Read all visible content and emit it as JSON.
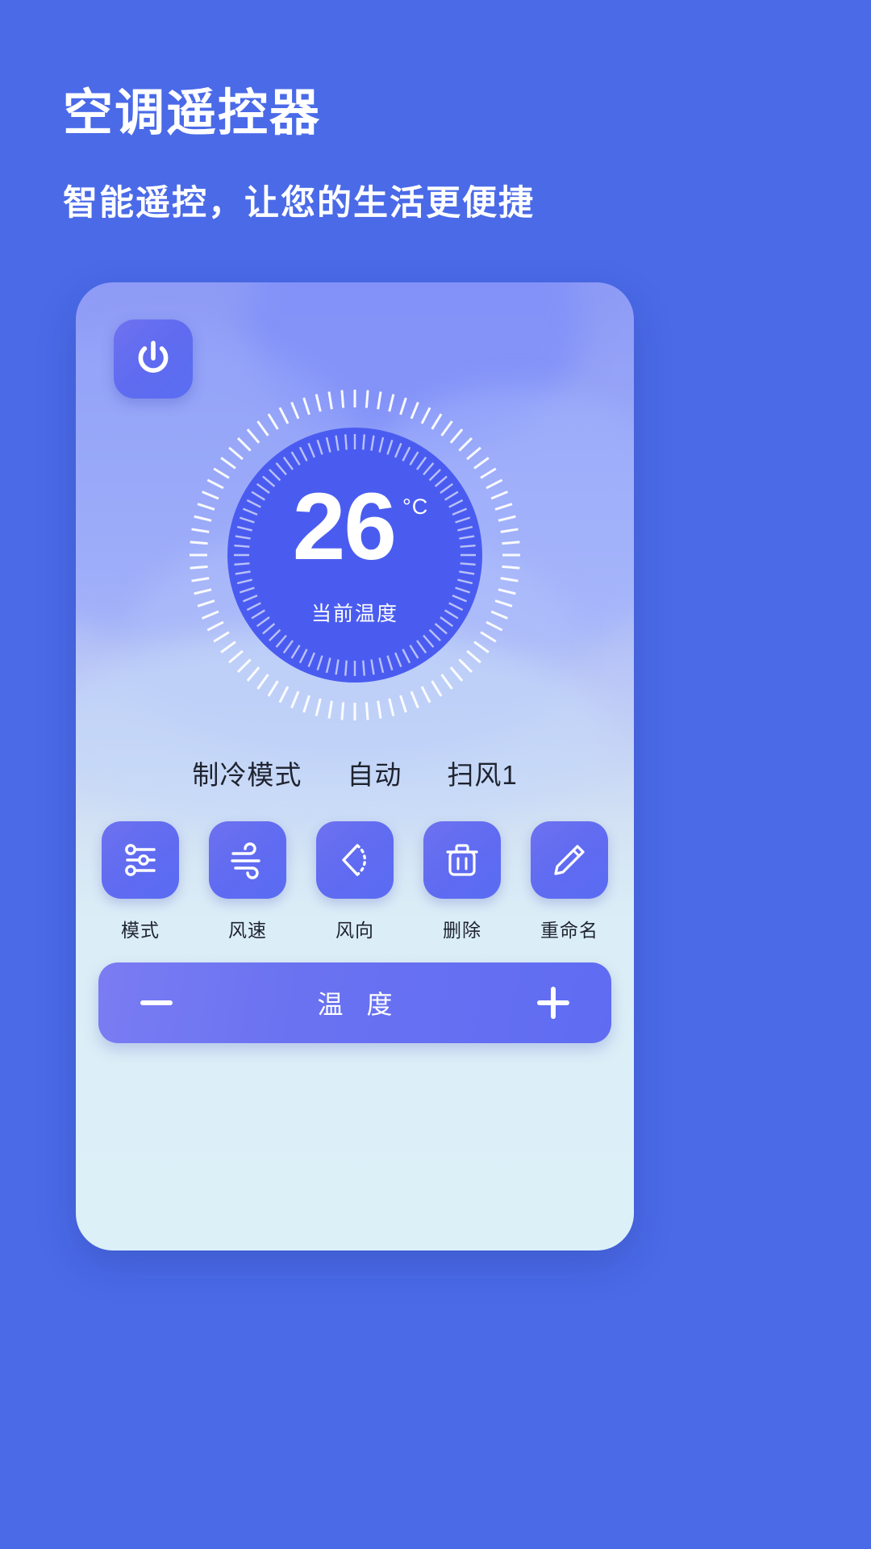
{
  "header": {
    "title": "空调遥控器",
    "subtitle": "智能遥控，让您的生活更便捷"
  },
  "theme": {
    "page_background": "#4a6ae8",
    "card_top": "#8e9bf6",
    "card_bottom": "#dcf0f8",
    "accent_button": "#5f6bf1",
    "dial_fill": "#4a5cf0",
    "text_dark": "#1f2330",
    "text_light": "#ffffff"
  },
  "remote": {
    "power_button": {
      "name": "power",
      "icon": "power-icon"
    },
    "dial": {
      "temperature": "26",
      "unit": "°C",
      "caption": "当前温度",
      "outer_ticks": 80,
      "inner_ticks": 80
    },
    "status": [
      {
        "label": "制冷模式"
      },
      {
        "label": "自动"
      },
      {
        "label": "扫风1"
      }
    ],
    "actions": [
      {
        "label": "模式",
        "icon": "sliders-icon"
      },
      {
        "label": "风速",
        "icon": "wind-icon"
      },
      {
        "label": "风向",
        "icon": "swing-direction-icon"
      },
      {
        "label": "删除",
        "icon": "trash-icon"
      },
      {
        "label": "重命名",
        "icon": "pencil-icon"
      }
    ],
    "stepper": {
      "minus_label": "−",
      "label": "温 度",
      "plus_label": "+"
    }
  }
}
